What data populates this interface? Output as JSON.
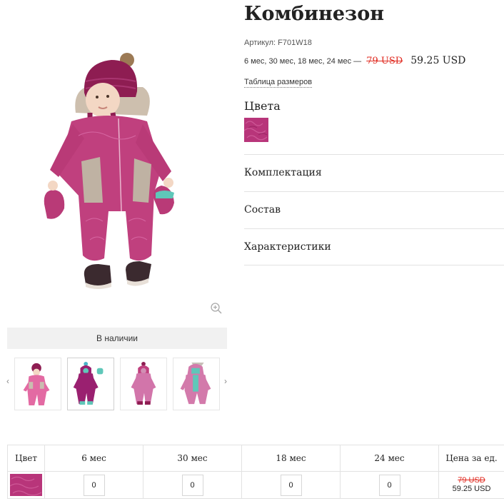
{
  "product": {
    "title": "Комбинезон",
    "sku": "Артикул: F701W18",
    "sizes_text": "6 мес, 30 мес, 18 мес, 24 мес —",
    "old_price": "79 USD",
    "new_price": "59.25 USD",
    "size_table_link": "Таблица размеров",
    "colors_heading": "Цвета"
  },
  "availability": "В наличии",
  "accordion": [
    {
      "label": "Комплектация"
    },
    {
      "label": "Состав"
    },
    {
      "label": "Характеристики"
    }
  ],
  "thumbnails": {
    "prev": "‹",
    "next": "›",
    "count": 4,
    "active_index": 1
  },
  "order_table": {
    "headers": [
      "Цвет",
      "6 мес",
      "30 мес",
      "18 мес",
      "24 мес",
      "Цена за ед."
    ],
    "row": {
      "quantities": [
        "0",
        "0",
        "0",
        "0"
      ],
      "unit_old_price": "79 USD",
      "unit_new_price": "59.25 USD"
    }
  },
  "icons": [
    "zoom-in-icon",
    "chevron-left-icon",
    "chevron-right-icon"
  ],
  "colors": {
    "accent_red": "#e0281e",
    "suit_pink": "#c0407e",
    "hat_berry": "#8e1d52"
  }
}
